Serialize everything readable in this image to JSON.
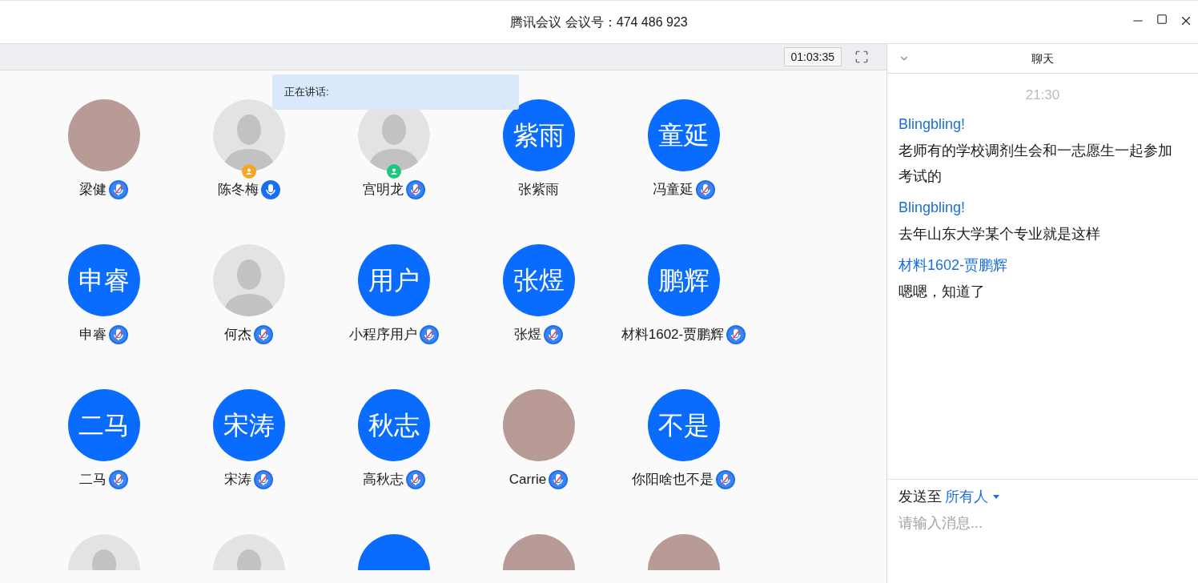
{
  "window": {
    "title": "腾讯会议 会议号：474 486 923"
  },
  "toolbar": {
    "timer": "01:03:35"
  },
  "speaking_tooltip": {
    "label": "正在讲话:"
  },
  "participants": [
    {
      "name": "梁健",
      "avatar": {
        "kind": "photo"
      },
      "mic": {
        "muted": true
      }
    },
    {
      "name": "陈冬梅",
      "avatar": {
        "kind": "default"
      },
      "badge": {
        "color": "#f5a623"
      },
      "mic": {
        "muted": false
      }
    },
    {
      "name": "宫明龙",
      "avatar": {
        "kind": "default"
      },
      "badge": {
        "color": "#1ec77c"
      },
      "mic": {
        "muted": true
      }
    },
    {
      "name": "张紫雨",
      "avatar": {
        "kind": "text",
        "text": "紫雨"
      }
    },
    {
      "name": "冯童延",
      "avatar": {
        "kind": "text",
        "text": "童延"
      },
      "mic": {
        "muted": true
      }
    },
    {
      "name": "申睿",
      "avatar": {
        "kind": "text",
        "text": "申睿"
      },
      "mic": {
        "muted": true
      }
    },
    {
      "name": "何杰",
      "avatar": {
        "kind": "default"
      },
      "mic": {
        "muted": true
      }
    },
    {
      "name": "小程序用户",
      "avatar": {
        "kind": "text",
        "text": "用户"
      },
      "mic": {
        "muted": true
      }
    },
    {
      "name": "张煜",
      "avatar": {
        "kind": "text",
        "text": "张煜"
      },
      "mic": {
        "muted": true
      }
    },
    {
      "name": "材料1602-贾鹏辉",
      "avatar": {
        "kind": "text",
        "text": "鹏辉"
      },
      "mic": {
        "muted": true
      }
    },
    {
      "name": "二马",
      "avatar": {
        "kind": "text",
        "text": "二马"
      },
      "mic": {
        "muted": true
      }
    },
    {
      "name": "宋涛",
      "avatar": {
        "kind": "text",
        "text": "宋涛"
      },
      "mic": {
        "muted": true
      }
    },
    {
      "name": "高秋志",
      "avatar": {
        "kind": "text",
        "text": "秋志"
      },
      "mic": {
        "muted": true
      }
    },
    {
      "name": "Carrie",
      "avatar": {
        "kind": "photo"
      },
      "mic": {
        "muted": true
      }
    },
    {
      "name": "你阳啥也不是",
      "avatar": {
        "kind": "text",
        "text": "不是"
      },
      "mic": {
        "muted": true
      }
    },
    {
      "avatar": {
        "kind": "default"
      }
    },
    {
      "avatar": {
        "kind": "default"
      }
    },
    {
      "avatar": {
        "kind": "text"
      }
    },
    {
      "avatar": {
        "kind": "photo"
      }
    },
    {
      "avatar": {
        "kind": "photo"
      }
    }
  ],
  "chat": {
    "title": "聊天",
    "time": "21:30",
    "messages": [
      {
        "sender": "Blingbling!",
        "text": "老师有的学校调剂生会和一志愿生一起参加考试的"
      },
      {
        "sender": "Blingbling!",
        "text": "去年山东大学某个专业就是这样"
      },
      {
        "sender": "材料1602-贾鹏辉",
        "text": "嗯嗯，知道了"
      }
    ],
    "send_to_label": "发送至",
    "recipient": "所有人",
    "placeholder": "请输入消息..."
  }
}
